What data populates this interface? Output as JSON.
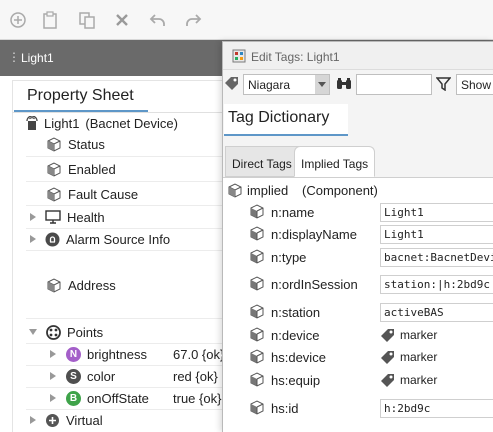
{
  "toolbar": {
    "buttons": [
      "add-icon",
      "paste-icon",
      "duplicate-icon",
      "delete-icon",
      "undo-icon",
      "redo-icon"
    ]
  },
  "pane": {
    "title": "Light1"
  },
  "property_sheet": {
    "tab_label": "Property Sheet",
    "root": {
      "name": "Light1",
      "type": "(Bacnet Device)"
    },
    "rows": [
      {
        "label": "Status"
      },
      {
        "label": "Enabled"
      },
      {
        "label": "Fault Cause"
      },
      {
        "label": "Health"
      },
      {
        "label": "Alarm Source Info"
      },
      {
        "label": "Address"
      },
      {
        "label": "Points"
      },
      {
        "label": "brightness",
        "value": "67.0 {ok}",
        "badge": "N"
      },
      {
        "label": "color",
        "value": "red {ok}",
        "badge": "S"
      },
      {
        "label": "onOffState",
        "value": "true {ok}",
        "badge": "B"
      },
      {
        "label": "Virtual"
      }
    ]
  },
  "dialog": {
    "title": "Edit Tags: Light1",
    "dictionary_select": "Niagara",
    "search_value": "",
    "filter_select": "Show All",
    "dictionary_tab": "Tag Dictionary",
    "tabs": [
      "Direct Tags",
      "Implied Tags"
    ],
    "active_tab": "Implied Tags",
    "implied_root": {
      "name": "implied",
      "type": "(Component)"
    },
    "tags": [
      {
        "name": "n:name",
        "value": "Light1"
      },
      {
        "name": "n:displayName",
        "value": "Light1"
      },
      {
        "name": "n:type",
        "value": "bacnet:BacnetDevice"
      },
      {
        "name": "n:ordInSession",
        "value": "station:|h:2bd9c"
      },
      {
        "name": "n:station",
        "value": "activeBAS"
      },
      {
        "name": "n:device",
        "value": "marker"
      },
      {
        "name": "hs:device",
        "value": "marker"
      },
      {
        "name": "hs:equip",
        "value": "marker"
      },
      {
        "name": "hs:id",
        "value": "h:2bd9c"
      }
    ]
  },
  "colors": {
    "accent": "#5e97c8",
    "header": "#6a6a6a",
    "badge_n": "#a45fc9",
    "badge_s": "#4f4f4f",
    "badge_b": "#3fa34a"
  }
}
